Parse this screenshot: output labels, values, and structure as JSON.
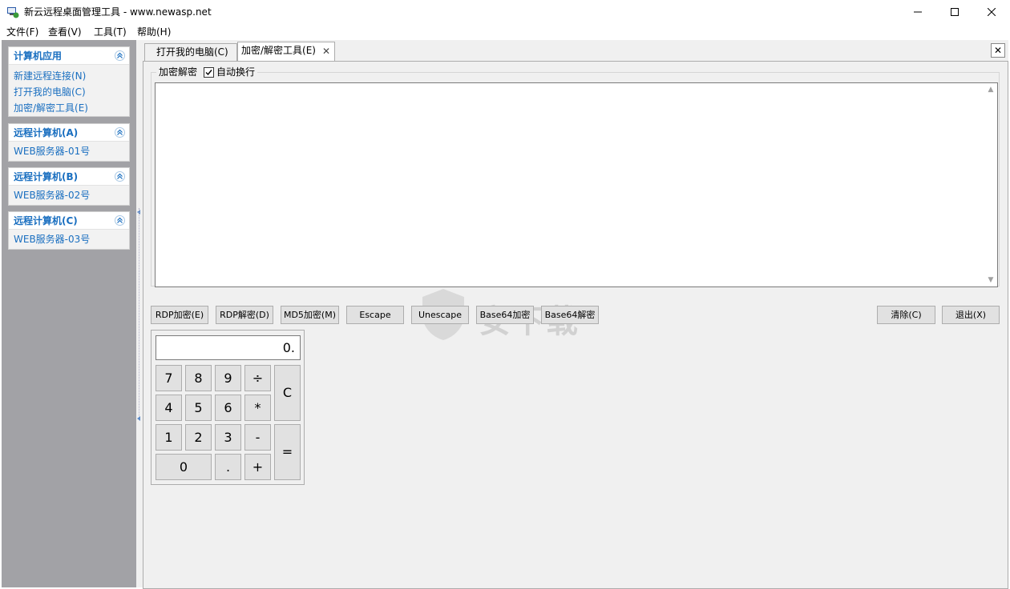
{
  "window": {
    "title": "新云远程桌面管理工具 - www.newasp.net",
    "minimize_icon": "minimize-icon",
    "maximize_icon": "maximize-icon",
    "close_icon": "close-icon"
  },
  "menu": {
    "items": [
      {
        "label": "文件(F)"
      },
      {
        "label": "查看(V)"
      },
      {
        "label": "工具(T)"
      },
      {
        "label": "帮助(H)"
      }
    ]
  },
  "sidebar": {
    "panels": [
      {
        "title": "计算机应用",
        "items": [
          "新建远程连接(N)",
          "打开我的电脑(C)",
          "加密/解密工具(E)"
        ]
      },
      {
        "title": "远程计算机(A)",
        "items": [
          "WEB服务器-01号"
        ]
      },
      {
        "title": "远程计算机(B)",
        "items": [
          "WEB服务器-02号"
        ]
      },
      {
        "title": "远程计算机(C)",
        "items": [
          "WEB服务器-03号"
        ]
      }
    ]
  },
  "tabs": [
    {
      "label": "打开我的电脑(C)",
      "active": false
    },
    {
      "label": "加密/解密工具(E)",
      "active": true,
      "close": "✕"
    }
  ],
  "main_close": "✕",
  "group": {
    "legend": "加密解密",
    "checkbox_label": "自动换行",
    "checkbox_checked": true,
    "text_value": ""
  },
  "buttons": {
    "rdp_encrypt": "RDP加密(E)",
    "rdp_decrypt": "RDP解密(D)",
    "md5_encrypt": "MD5加密(M)",
    "escape": "Escape",
    "unescape": "Unescape",
    "base64_encrypt": "Base64加密",
    "base64_decrypt": "Base64解密",
    "clear": "清除(C)",
    "exit": "退出(X)"
  },
  "watermark": {
    "text": "安下载"
  },
  "calculator": {
    "display": "0.",
    "keys": {
      "k7": "7",
      "k8": "8",
      "k9": "9",
      "div": "÷",
      "k4": "4",
      "k5": "5",
      "k6": "6",
      "mul": "*",
      "k1": "1",
      "k2": "2",
      "k3": "3",
      "sub": "-",
      "k0": "0",
      "dot": ".",
      "add": "+",
      "clear": "C",
      "equals": "="
    }
  },
  "colors": {
    "sidebar_bg": "#a2a2a6",
    "link": "#1a6fc0",
    "surface": "#f0f0f0"
  }
}
